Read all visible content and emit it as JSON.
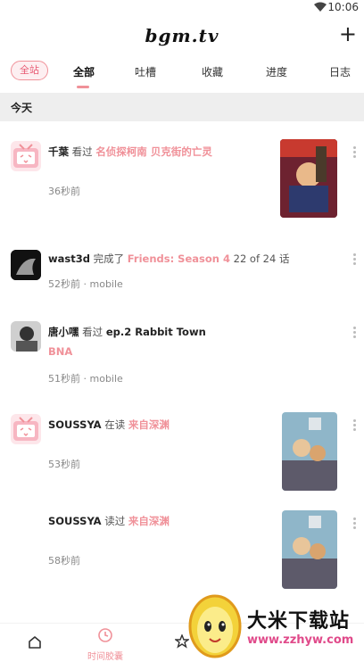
{
  "status": {
    "time": "10:06"
  },
  "app": {
    "logo": "bgm.tv",
    "add_label": "+"
  },
  "tabs": {
    "pill": "全站",
    "items": [
      "全部",
      "吐槽",
      "收藏",
      "进度",
      "日志"
    ],
    "active": 0
  },
  "section": {
    "title": "今天"
  },
  "feed": [
    {
      "user": "千葉",
      "action": "看过",
      "subject": "名侦探柯南 贝克街的亡灵",
      "time": "36秒前"
    },
    {
      "user": "wast3d",
      "action": "完成了",
      "subject": "Friends: Season 4",
      "extra": "22 of 24 话",
      "time": "52秒前",
      "source": "mobile"
    },
    {
      "user": "唐小嘿",
      "action": "看过",
      "detail": "ep.2 Rabbit Town",
      "subject": "BNA",
      "time": "51秒前",
      "source": "mobile"
    },
    {
      "user": "SOUSSYA",
      "action": "在读",
      "subject": "来自深渊",
      "time": "53秒前"
    },
    {
      "user": "SOUSSYA",
      "action": "读过",
      "subject": "来自深渊",
      "time": "58秒前"
    }
  ],
  "nav": {
    "timeline_label": "时间胶囊"
  },
  "watermark": {
    "title": "大米下载站",
    "url": "www.zzhyw.com"
  },
  "colors": {
    "accent": "#f09199",
    "link": "#f09199"
  }
}
